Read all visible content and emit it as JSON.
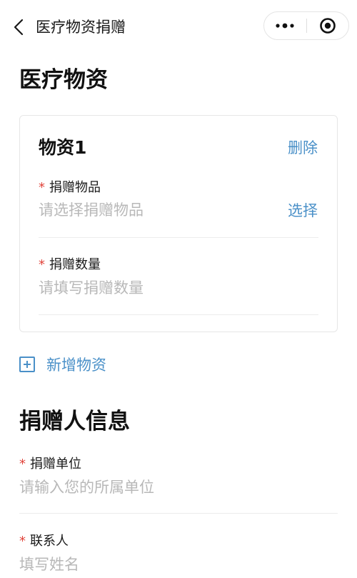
{
  "nav": {
    "title": "医疗物资捐赠",
    "back_icon": "chevron-left-icon",
    "more_icon": "more-dots-icon",
    "close_icon": "target-circle-icon"
  },
  "section_medical": {
    "title": "医疗物资",
    "card": {
      "title": "物资1",
      "delete_label": "删除",
      "item_field": {
        "required_mark": "*",
        "label": "捐赠物品",
        "placeholder": "请选择捐赠物品",
        "action_label": "选择"
      },
      "quantity_field": {
        "required_mark": "*",
        "label": "捐赠数量",
        "placeholder": "请填写捐赠数量"
      }
    },
    "add_label": "新增物资"
  },
  "section_donor": {
    "title": "捐赠人信息",
    "unit_field": {
      "required_mark": "*",
      "label": "捐赠单位",
      "placeholder": "请输入您的所属单位"
    },
    "contact_field": {
      "required_mark": "*",
      "label": "联系人",
      "placeholder": "填写姓名"
    }
  },
  "colors": {
    "link": "#4a90c8",
    "required": "#e0433a",
    "placeholder": "#b8b8b8"
  }
}
